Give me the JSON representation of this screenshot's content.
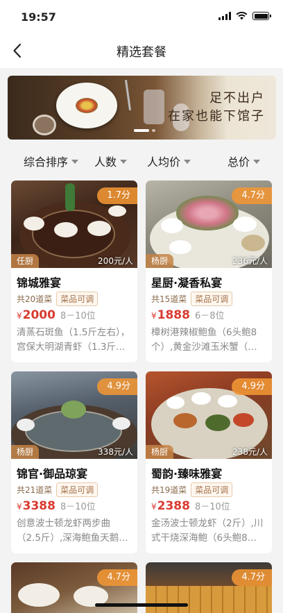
{
  "status": {
    "time": "19:57"
  },
  "nav": {
    "title": "精选套餐"
  },
  "banner": {
    "line1": "足不出户",
    "line2": "在家也能下馆子"
  },
  "filters": [
    {
      "label": "综合排序"
    },
    {
      "label": "人数"
    },
    {
      "label": "人均价"
    },
    {
      "label": "总价"
    }
  ],
  "cards": [
    {
      "score": "1.7分",
      "chef": "任厨",
      "per_person": "200元/人",
      "name": "锦城雅宴",
      "count": "共20道菜",
      "tag": "菜品可调",
      "yen": "¥",
      "price": "2000",
      "seats": "8－10位",
      "dishes": "清蒸石斑鱼（1.5斤左右），宫保大明湖青虾（1.3斤…"
    },
    {
      "score": "4.7分",
      "chef": "杨厨",
      "per_person": "236元/人",
      "name": "星厨·凝香私宴",
      "count": "共15道菜",
      "tag": "菜品可调",
      "yen": "¥",
      "price": "1888",
      "seats": "6－8位",
      "dishes": "樟树港辣椒鲍鱼（6头鲍8个）,黄金沙滩玉米蟹（…"
    },
    {
      "score": "4.9分",
      "chef": "杨厨",
      "per_person": "338元/人",
      "name": "锦官·御品琼宴",
      "count": "共21道菜",
      "tag": "菜品可调",
      "yen": "¥",
      "price": "3388",
      "seats": "8－10位",
      "dishes": "创意波士顿龙虾两步曲（2.5斤）,深海鲍鱼天鹅…"
    },
    {
      "score": "4.9分",
      "chef": "杨厨",
      "per_person": "238元/人",
      "name": "蜀韵·臻味雅宴",
      "count": "共19道菜",
      "tag": "菜品可调",
      "yen": "¥",
      "price": "2388",
      "seats": "8－10位",
      "dishes": "金汤波士顿龙虾（2斤）,川式干烧深海鲍（6头鲍8…"
    },
    {
      "score": "4.7分"
    },
    {
      "score": "4.7分"
    }
  ],
  "colors": {
    "accent_price": "#d93a2f",
    "score_badge": "#f19634",
    "chef_badge": "#c48446"
  }
}
